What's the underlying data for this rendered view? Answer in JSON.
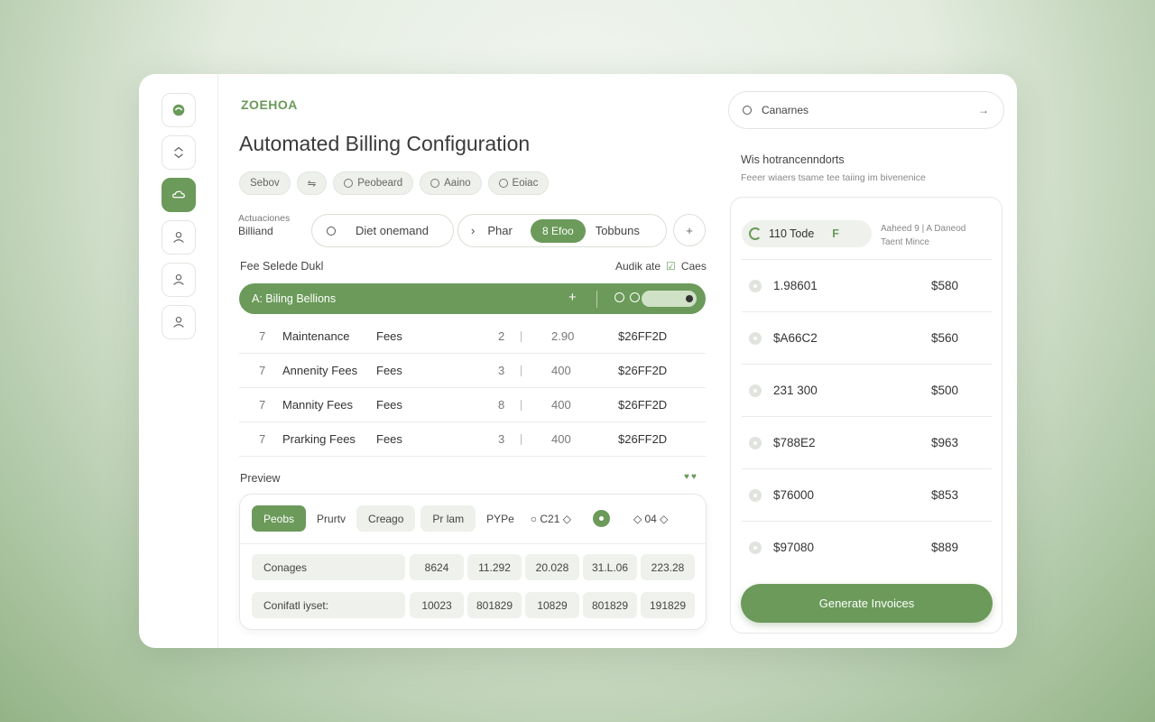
{
  "brand": "ZOEHOA",
  "title": "Automated Billing Configuration",
  "chips": [
    "Sebov",
    "",
    "Peobeard",
    "Aaino",
    "Eoiac"
  ],
  "selector": {
    "label_top": "Actuaciones",
    "label_main": "Billiand",
    "dropdown": "Diet onemand",
    "segment_a": "Phar",
    "segment_selected": "8 Efoo",
    "segment_c": "Tobbuns",
    "add": "+"
  },
  "fee_section": {
    "label": "Fee Selede Dukl",
    "right_label": "Audik ate",
    "right_icon_label": "Caes"
  },
  "billing_bar": {
    "label": "A: Biling Bellions",
    "plus": "+"
  },
  "fees": [
    {
      "num": "7",
      "name": "Maintenance",
      "type": "Fees",
      "qty": "2",
      "price": "2.90",
      "total": "$26FF2D"
    },
    {
      "num": "7",
      "name": "Annenity Fees",
      "type": "Fees",
      "qty": "3",
      "price": "400",
      "total": "$26FF2D"
    },
    {
      "num": "7",
      "name": "Mannity Fees",
      "type": "Fees",
      "qty": "8",
      "price": "400",
      "total": "$26FF2D"
    },
    {
      "num": "7",
      "name": "Prarking Fees",
      "type": "Fees",
      "qty": "3",
      "price": "400",
      "total": "$26FF2D"
    }
  ],
  "preview": {
    "label": "Preview",
    "tabs": [
      "Peobs",
      "Prurtv",
      "Creago",
      "Pr lam",
      "PYPe",
      "○ C21 ◇",
      "◇ 04 ◇"
    ],
    "rows": [
      {
        "label": "Conages",
        "cells": [
          "8624",
          "11.292",
          "20.028",
          "31.L.06",
          "223.28"
        ]
      },
      {
        "label": "Conifatl iyset:",
        "cells": [
          "10023",
          "801829",
          "10829",
          "801829",
          "191829"
        ]
      }
    ]
  },
  "right_panel": {
    "search_label": "Canarnes",
    "search_arrow": "→",
    "title": "Wis hotrancenndorts",
    "subtitle": "Feeer wiaers tsame tee taiing im bivenenice",
    "top_label": "110 Tode",
    "top_flag": "F",
    "note_line1": "Aaheed 9 | A Daneod",
    "note_line2": "Taent Mince",
    "invoices": [
      {
        "id": "1.98601",
        "amount": "$580"
      },
      {
        "id": "$A66C2",
        "amount": "$560"
      },
      {
        "id": "231 300",
        "amount": "$500"
      },
      {
        "id": "$788E2",
        "amount": "$963"
      },
      {
        "id": "$76000",
        "amount": "$853"
      },
      {
        "id": "$97080",
        "amount": "$889"
      }
    ],
    "generate_button": "Generate Invoices"
  },
  "colors": {
    "accent": "#6b9a5a",
    "surface": "#ffffff",
    "chip_bg": "#eef0ec"
  },
  "icons": [
    "app-logo-icon",
    "chevron-updown-icon",
    "cloud-icon",
    "user-icon",
    "person-icon",
    "account-icon"
  ]
}
